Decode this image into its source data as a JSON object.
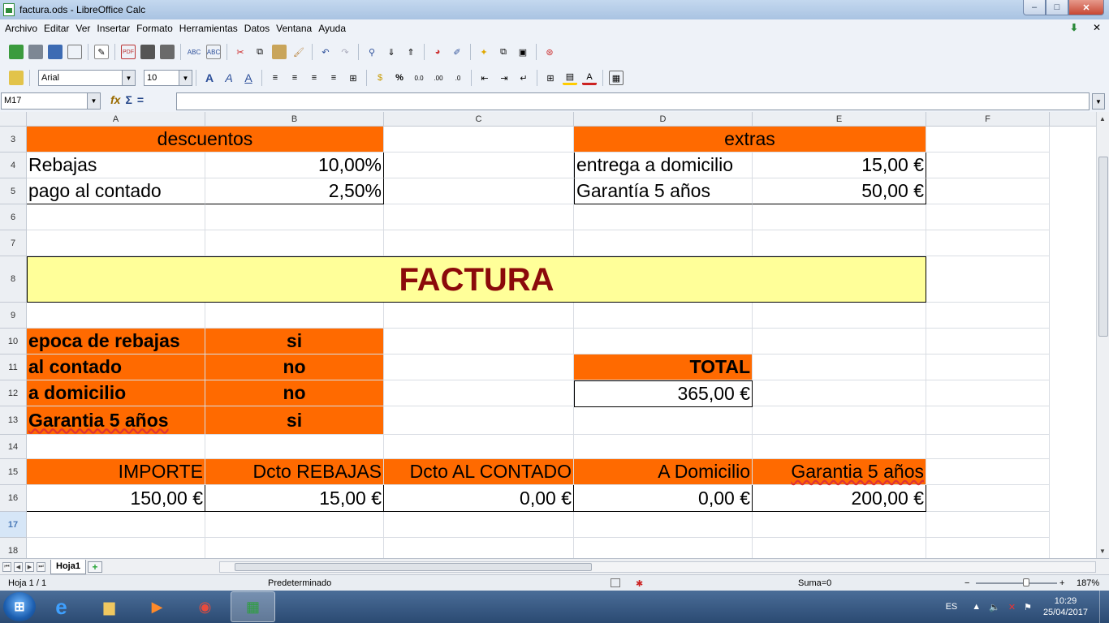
{
  "window": {
    "title": "factura.ods - LibreOffice Calc",
    "min": "–",
    "max": "□",
    "close": "✕"
  },
  "menu": [
    "Archivo",
    "Editar",
    "Ver",
    "Insertar",
    "Formato",
    "Herramientas",
    "Datos",
    "Ventana",
    "Ayuda"
  ],
  "toolbar": {
    "font_name": "Arial",
    "font_size": "10"
  },
  "formula_bar": {
    "name_box": "M17",
    "formula": ""
  },
  "sheet": {
    "columns": [
      "A",
      "B",
      "C",
      "D",
      "E",
      "F"
    ],
    "rows": [
      "3",
      "4",
      "5",
      "6",
      "7",
      "8",
      "9",
      "10",
      "11",
      "12",
      "13",
      "14",
      "15",
      "16",
      "17",
      "18"
    ],
    "selected_row": "17",
    "descuentos": {
      "header": "descuentos",
      "items": [
        {
          "label": "Rebajas",
          "value": "10,00%"
        },
        {
          "label": "pago al contado",
          "value": "2,50%"
        }
      ]
    },
    "extras": {
      "header": "extras",
      "items": [
        {
          "label": "entrega a domicilio",
          "value": "15,00 €"
        },
        {
          "label": "Garantía 5 años",
          "value": "50,00 €"
        }
      ]
    },
    "factura_title": "FACTURA",
    "options": [
      {
        "label": "epoca de rebajas",
        "value": "si"
      },
      {
        "label": "al contado",
        "value": "no"
      },
      {
        "label": "a domicilio",
        "value": "no"
      },
      {
        "label": "Garantia 5 años",
        "value": "si"
      }
    ],
    "total": {
      "label": "TOTAL",
      "value": "365,00 €"
    },
    "summary_headers": [
      "IMPORTE",
      "Dcto REBAJAS",
      "Dcto AL CONTADO",
      "A Domicilio",
      "Garantia 5 años"
    ],
    "summary_values": [
      "150,00 €",
      "15,00 €",
      "0,00 €",
      "0,00 €",
      "200,00 €"
    ]
  },
  "tabs": {
    "sheet_tab": "Hoja1",
    "add": "+"
  },
  "status": {
    "sheet": "Hoja 1 / 1",
    "style": "Predeterminado",
    "sum": "Suma=0",
    "zoom": "187%",
    "zoom_percent": 187
  },
  "taskbar": {
    "language": "ES",
    "time": "10:29",
    "date": "25/04/2017"
  }
}
